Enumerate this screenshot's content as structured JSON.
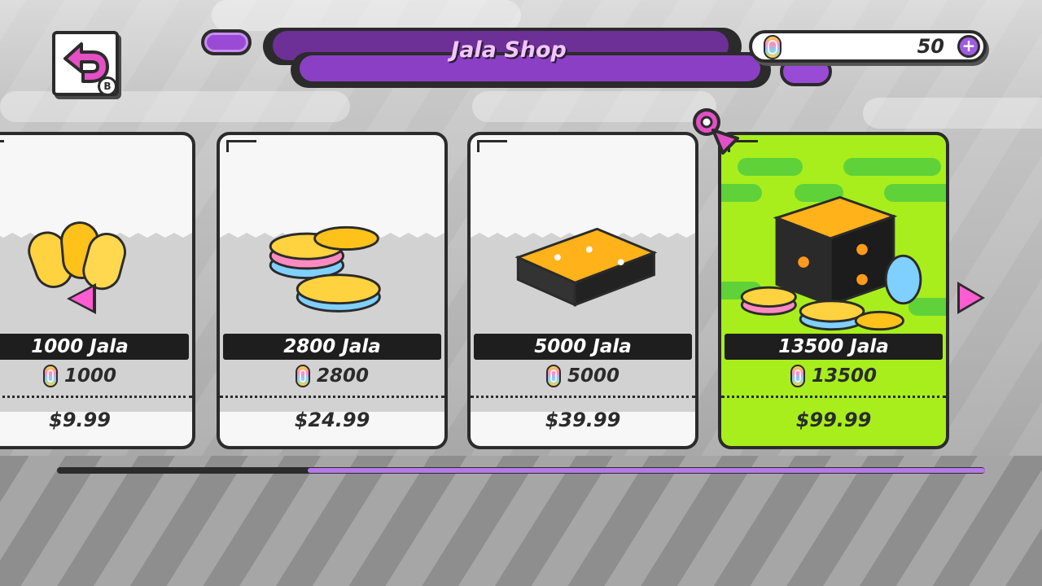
{
  "header": {
    "title": "Jala Shop",
    "back_button_hint": "B"
  },
  "currency": {
    "balance": "50",
    "add_label": "+"
  },
  "products": [
    {
      "name": "1000 Jala",
      "amount": "1000",
      "price": "$9.99",
      "selected": false
    },
    {
      "name": "2800 Jala",
      "amount": "2800",
      "price": "$24.99",
      "selected": false
    },
    {
      "name": "5000 Jala",
      "amount": "5000",
      "price": "$39.99",
      "selected": false
    },
    {
      "name": "13500 Jala",
      "amount": "13500",
      "price": "$99.99",
      "selected": true
    }
  ],
  "scroll": {
    "position_fraction": 0.27,
    "thumb_fraction": 0.73
  },
  "colors": {
    "accent_purple": "#8b3fc4",
    "selected_card": "#a8ee1c",
    "arrow_pink": "#ff5cd2"
  },
  "icons": [
    "back-arrow-icon",
    "coin-icon",
    "plus-icon",
    "arrow-left-icon",
    "arrow-right-icon",
    "selection-cursor-icon"
  ]
}
